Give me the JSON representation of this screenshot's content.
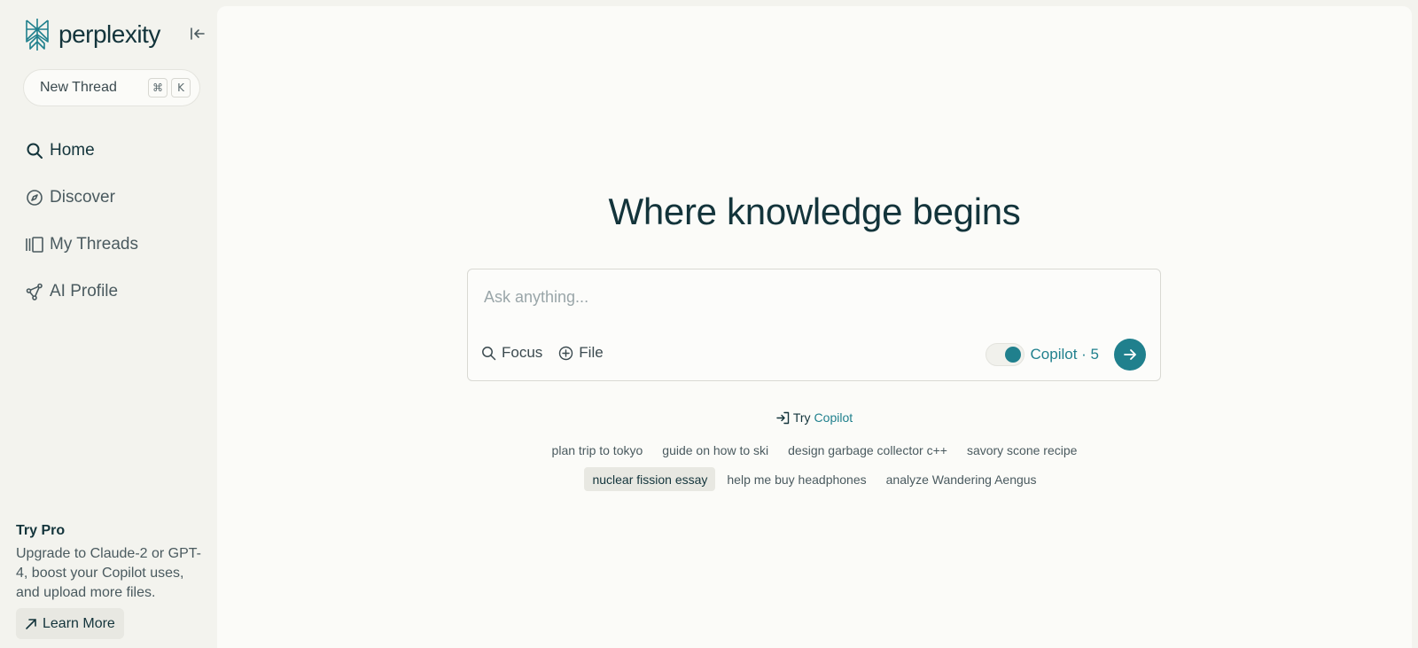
{
  "brand": {
    "name": "perplexity",
    "accent": "#20808d"
  },
  "sidebar": {
    "new_thread_label": "New Thread",
    "shortcut_keys": [
      "⌘",
      "K"
    ],
    "nav": [
      {
        "label": "Home",
        "icon": "search-icon",
        "active": true
      },
      {
        "label": "Discover",
        "icon": "compass-icon"
      },
      {
        "label": "My Threads",
        "icon": "library-icon"
      },
      {
        "label": "AI Profile",
        "icon": "share-nodes-icon"
      }
    ],
    "promo": {
      "title": "Try Pro",
      "text": "Upgrade to Claude-2 or GPT-4, boost your Copilot uses, and upload more files.",
      "button_label": "Learn More"
    }
  },
  "main": {
    "headline": "Where knowledge begins",
    "ask": {
      "placeholder": "Ask anything...",
      "value": "",
      "tools": [
        "Focus",
        "File"
      ],
      "copilot_label": "Copilot · 5",
      "copilot_enabled": true
    },
    "try": {
      "label": "Try",
      "link": "Copilot"
    },
    "suggestions_row1": [
      "plan trip to tokyo",
      "guide on how to ski",
      "design garbage collector c++",
      "savory scone recipe"
    ],
    "suggestions_row2": [
      "nuclear fission essay",
      "help me buy headphones",
      "analyze Wandering Aengus"
    ]
  }
}
